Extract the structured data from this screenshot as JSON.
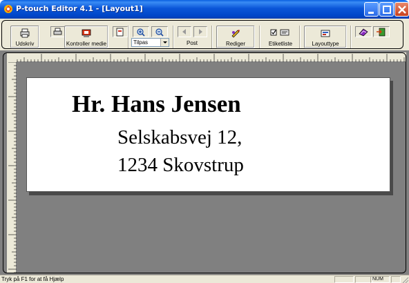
{
  "window": {
    "title": "P-touch Editor 4.1 - [Layout1]"
  },
  "toolbar": {
    "print_label": "Udskriv",
    "check_media_label": "Kontroller medie",
    "zoom_value": "Tilpas",
    "post_label": "Post",
    "edit_label": "Rediger",
    "label_list_label": "Etiketliste",
    "layout_type_label": "Layouttype"
  },
  "label": {
    "name": "Hr. Hans Jensen",
    "street": "Selskabsvej 12,",
    "city": "1234 Skovstrup"
  },
  "status": {
    "help_text": "Tryk på F1 for at få Hjælp",
    "num_indicator": "NUM"
  },
  "colors": {
    "titlebar": "#0a55d8",
    "toolbar_bg": "#ece9d8",
    "workspace_bg": "#808080",
    "label_paper": "#ffffff"
  }
}
